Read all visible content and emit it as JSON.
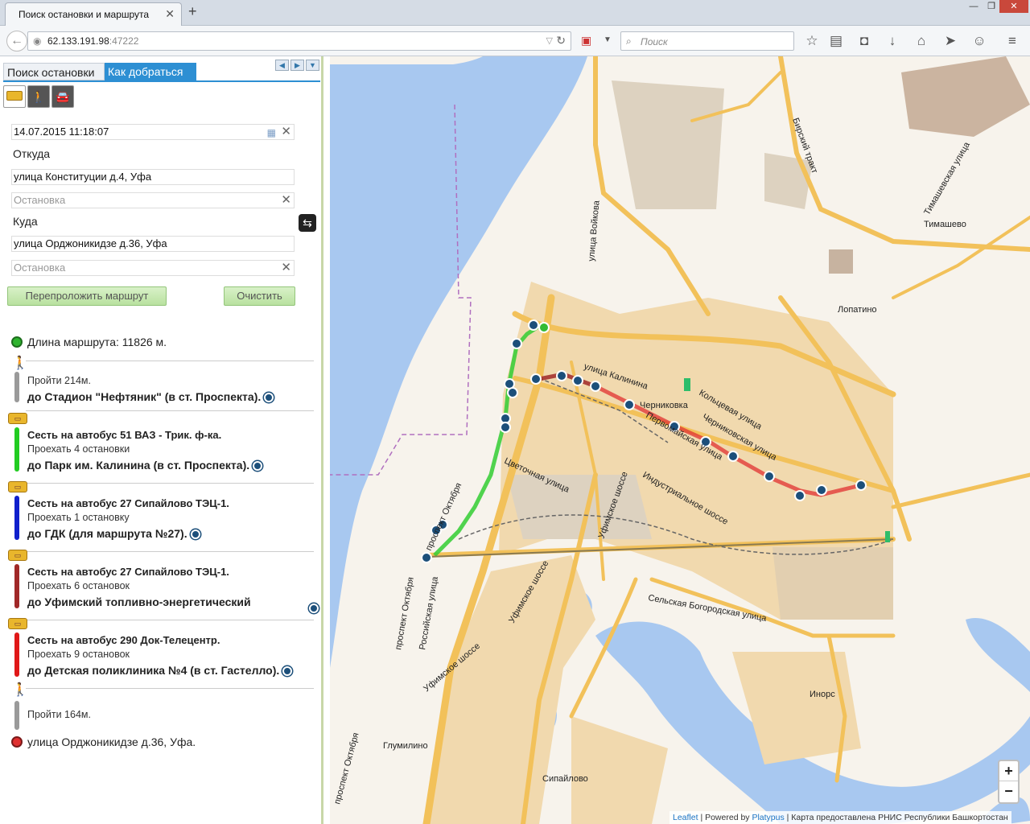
{
  "browser": {
    "tab_title": "Поиск остановки и маршрута",
    "new_tab": "+",
    "url_host": "62.133.191.98",
    "url_port": ":47222",
    "search_placeholder": "Поиск"
  },
  "panel": {
    "tabs": [
      "Поиск остановки",
      "Как добраться"
    ],
    "active_tab": "Как добраться",
    "modes": [
      "bus-icon",
      "walk-icon",
      "car-icon"
    ],
    "datetime": "14.07.2015 11:18:07",
    "from_label": "Откуда",
    "from_value": "улица Конституции д.4, Уфа",
    "from_stop_placeholder": "Остановка",
    "to_label": "Куда",
    "to_value": "улица Орджоникидзе д.36, Уфа",
    "to_stop_placeholder": "Остановка",
    "reroute_button": "Перепроложить маршрут",
    "clear_button": "Очистить"
  },
  "route": {
    "length": "Длина маршрута: 11826 м.",
    "legs": [
      {
        "type": "walk",
        "line1": "Пройти 214м.",
        "line2": "до Стадион \"Нефтяник\" (в ст. Проспекта).",
        "color": "#9a9a9a"
      },
      {
        "type": "bus",
        "line1": "Сесть на автобус 51 ВАЗ - Трик. ф-ка.",
        "line2": "Проехать 4 остановки",
        "line3": "до Парк им. Калинина (в ст. Проспекта).",
        "color": "#22cc22"
      },
      {
        "type": "bus",
        "line1": "Сесть на автобус 27 Сипайлово ТЭЦ-1.",
        "line2": "Проехать 1 остановку",
        "line3": "до ГДК (для маршрута №27).",
        "color": "#1020cc"
      },
      {
        "type": "bus",
        "line1": "Сесть на автобус 27 Сипайлово ТЭЦ-1.",
        "line2": "Проехать 6 остановок",
        "line3": "до Уфимский топливно-энергетический",
        "color": "#a02828"
      },
      {
        "type": "bus",
        "line1": "Сесть на автобус 290 Док-Телецентр.",
        "line2": "Проехать 9 остановок",
        "line3": "до Детская поликлиника №4 (в ст. Гастелло).",
        "color": "#e01818"
      },
      {
        "type": "walk",
        "line1": "Пройти 164м.",
        "color": "#9a9a9a"
      }
    ],
    "destination": "улица Орджоникидзе д.36, Уфа."
  },
  "map": {
    "labels": {
      "kalinina": "улица Калинина",
      "chernikovka": "Черниковка",
      "pervomayskaya": "Первомайская улица",
      "koltsevaya": "Кольцевая улица",
      "chernikovskaya": "Черниковская улица",
      "tsvetochnaya": "Цветочная улица",
      "industrialnoe": "Индустриальное шоссе",
      "ufimskoe1": "Уфимское шоссе",
      "ufimskoe2": "Уфимское шоссе",
      "ufimskoe3": "Уфимское шоссе",
      "selskaya": "Сельская Богородская улица",
      "rossiyskaya": "Российская улица",
      "oktyabrya1": "проспект Октября",
      "oktyabrya2": "проспект Октября",
      "oktyabrya3": "проспект Октября",
      "voykova": "улица Войкова",
      "birskiy": "Бирский тракт",
      "timashevskaya": "Тимашевская улица",
      "timashevo": "Тимашево",
      "lopatino": "Лопатино",
      "inors": "Инорс",
      "glumilino": "Глумилино",
      "sipaylovo": "Сипайлово"
    },
    "zoom_in": "+",
    "zoom_out": "−",
    "attribution_leaflet": "Leaflet",
    "attribution_powered": " | Powered by ",
    "attribution_platypus": "Platypus",
    "attribution_rest": " | Карта предоставлена РНИС Республики Башкортостан",
    "colors": {
      "water": "#a8c8f0",
      "land": "#f7f3ec",
      "road": "#f2c15a",
      "urban": "#f1d9ae",
      "industrial": "#ddd2c0"
    }
  }
}
